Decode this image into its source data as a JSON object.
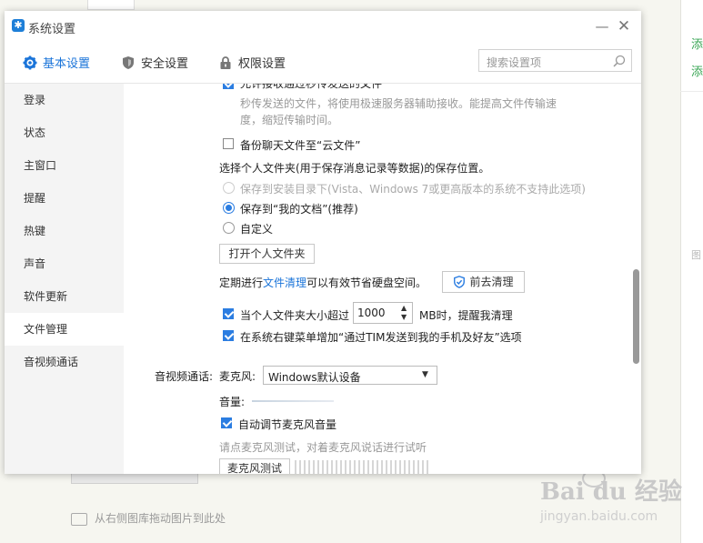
{
  "background": {
    "hint_text": "从右侧图库拖动图片到此处",
    "right_texts": [
      "添",
      "添",
      "图"
    ],
    "watermark": "Bai du 经验",
    "watermark_sub": "jingyan.baidu.com"
  },
  "window": {
    "title": "系统设置",
    "nav_tabs": [
      {
        "label": "基本设置",
        "icon": "gear-icon",
        "active": true
      },
      {
        "label": "安全设置",
        "icon": "shield-icon",
        "active": false
      },
      {
        "label": "权限设置",
        "icon": "lock-icon",
        "active": false
      }
    ],
    "search_placeholder": "搜索设置项",
    "accent_color": "#1a74d9"
  },
  "sidebar": {
    "items": [
      {
        "label": "登录"
      },
      {
        "label": "状态"
      },
      {
        "label": "主窗口"
      },
      {
        "label": "提醒"
      },
      {
        "label": "热键"
      },
      {
        "label": "声音"
      },
      {
        "label": "软件更新"
      },
      {
        "label": "文件管理",
        "active": true
      },
      {
        "label": "音视频通话"
      }
    ]
  },
  "content": {
    "allow_quick_send_label": "允许接收通过秒传发送的文件",
    "quick_send_desc_line1": "秒传发送的文件，将使用极速服务器辅助接收。能提高文件传输速",
    "quick_send_desc_line2": "度，缩短传输时间。",
    "backup_cloud_label": "备份聊天文件至“云文件”",
    "folder_prompt": "选择个人文件夹(用于保存消息记录等数据)的保存位置。",
    "radio_install_dir": "保存到安装目录下(Vista、Windows 7或更高版本的系统不支持此选项)",
    "radio_my_docs": "保存到“我的文档”(推荐)",
    "radio_custom": "自定义",
    "open_folder_button": "打开个人文件夹",
    "cleanup_prefix": "定期进行",
    "cleanup_link": "文件清理",
    "cleanup_suffix": "可以有效节省硬盘空间。",
    "cleanup_button": "前去清理",
    "size_limit_prefix": "当个人文件夹大小超过",
    "size_limit_value": "1000",
    "size_limit_suffix": "MB时，提醒我清理",
    "context_menu_label": "在系统右键菜单增加“通过TIM发送到我的手机及好友”选项",
    "av_section_label": "音视频通话:",
    "mic_label": "麦克风:",
    "mic_selected": "Windows默认设备",
    "volume_label": "音量:",
    "auto_adjust_label": "自动调节麦克风音量",
    "mic_test_hint": "请点麦克风测试，对着麦克风说话进行试听",
    "mic_test_button": "麦克风测试"
  }
}
